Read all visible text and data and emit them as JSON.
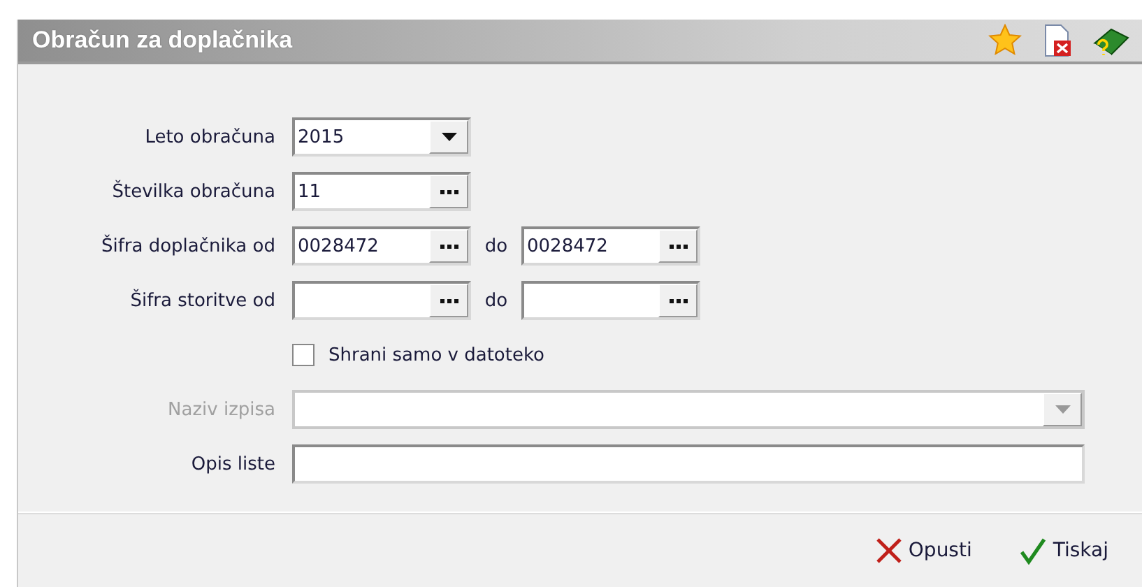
{
  "window": {
    "title": "Obračun za doplačnika"
  },
  "fields": [
    {
      "kind": "combo",
      "label": "Leto obračuna",
      "value": "2015",
      "disabled": false
    },
    {
      "kind": "lookup",
      "label": "Številka obračuna",
      "value": "11",
      "disabled": false
    },
    {
      "kind": "range",
      "label": "Šifra doplačnika od",
      "value": "0028472",
      "separator": "do",
      "value_to": "0028472",
      "disabled": false
    },
    {
      "kind": "range",
      "label": "Šifra storitve od",
      "separator": "do",
      "disabled": false
    },
    {
      "kind": "checkbox",
      "label": "Shrani samo v datoteko",
      "checked": false,
      "disabled": false
    },
    {
      "kind": "wide_combo",
      "label": "Naziv izpisa",
      "disabled": true
    },
    {
      "kind": "text",
      "label": "Opis liste",
      "disabled": false
    }
  ],
  "buttons": [
    {
      "kind": "cancel",
      "label": "Opusti"
    },
    {
      "kind": "ok",
      "label": "Tiskaj"
    }
  ]
}
